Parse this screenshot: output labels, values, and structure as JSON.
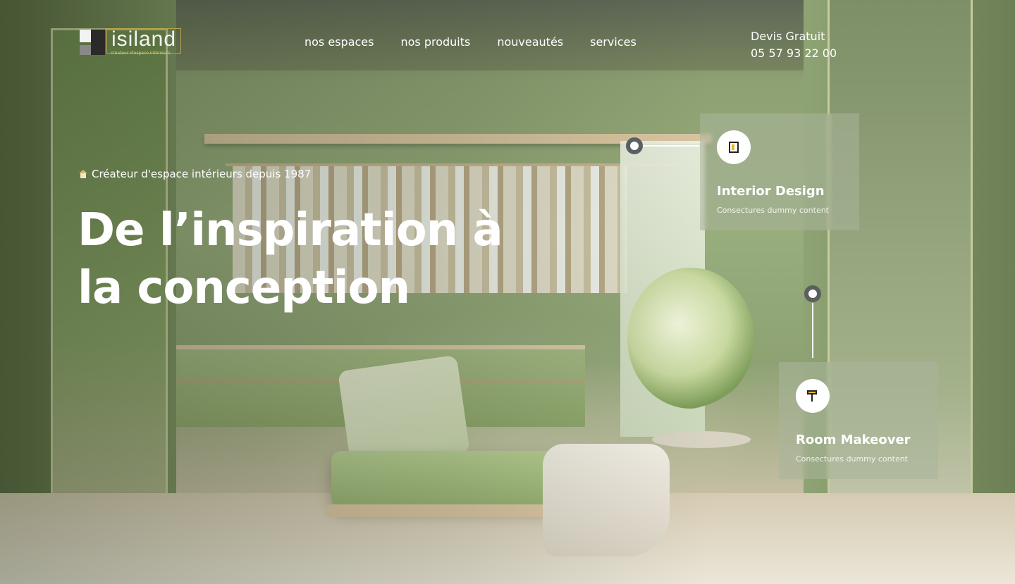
{
  "header": {
    "logo_text": "isiland",
    "logo_tagline": "créateur d'espace intérieurs",
    "nav": [
      "nos espaces",
      "nos produits",
      "nouveautés",
      "services"
    ],
    "contact_label": "Devis Gratuit",
    "contact_phone": "05 57 93 22 00"
  },
  "hero": {
    "tagline": "Créateur d'espace intérieurs depuis 1987",
    "title_line1": "De l’inspiration à",
    "title_line2": "la conception"
  },
  "cards": [
    {
      "title": "Interior Design",
      "subtitle": "Consectures dummy content",
      "icon": "frame-icon"
    },
    {
      "title": "Room Makeover",
      "subtitle": "Consectures dummy content",
      "icon": "paint-roller-icon"
    }
  ],
  "colors": {
    "accent": "#e8b622",
    "pin": "#5a5f60"
  }
}
